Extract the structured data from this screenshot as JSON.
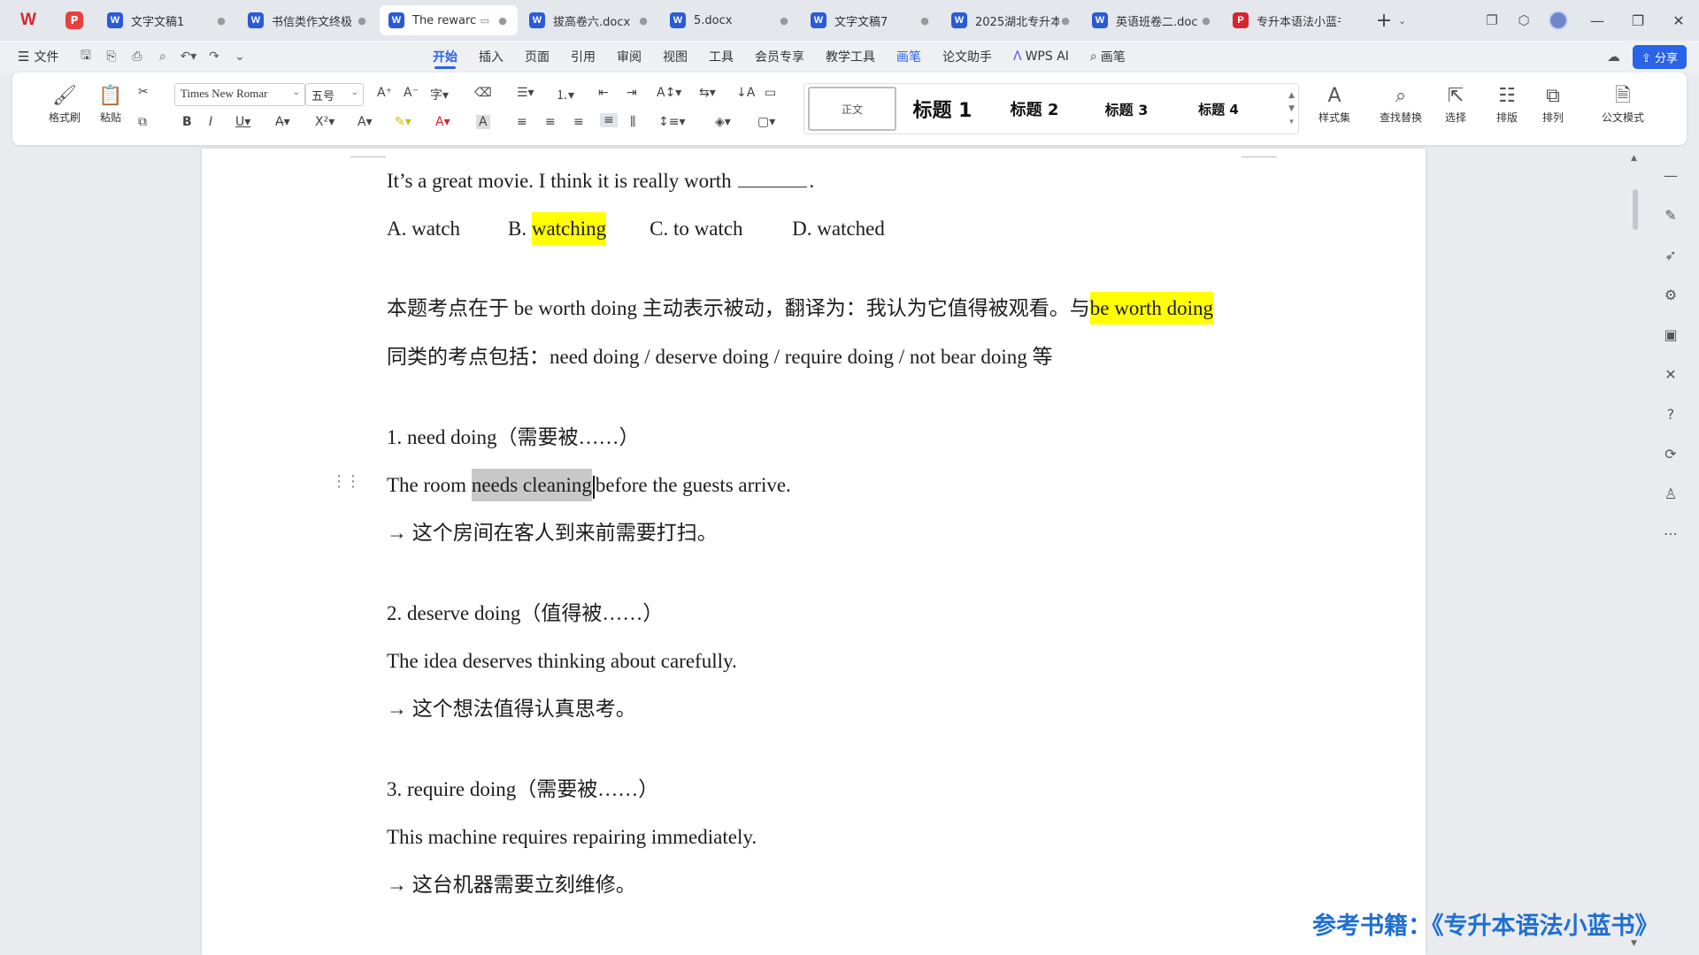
{
  "tabbar": {
    "app_logo": "W",
    "pdf_badge": "P",
    "tabs": [
      {
        "icon": "W",
        "label": "文字文稿1",
        "close": "●"
      },
      {
        "icon": "W",
        "label": "书信类作文终极",
        "close": "●"
      },
      {
        "icon": "W",
        "label": "The rewarc",
        "close": "●"
      },
      {
        "icon": "W",
        "label": "拔高卷六.docx",
        "close": "●"
      },
      {
        "icon": "W",
        "label": "5.docx",
        "close": "●"
      },
      {
        "icon": "W",
        "label": "文字文稿7",
        "close": "●"
      },
      {
        "icon": "W",
        "label": "2025湖北专升本",
        "close": "●"
      },
      {
        "icon": "W",
        "label": "英语班卷二.doc",
        "close": "●"
      },
      {
        "icon": "P",
        "label": "专升本语法小蓝书",
        "close": ""
      }
    ],
    "new_tab": "+",
    "tab_list": "⌄"
  },
  "menubar": {
    "file_label": "文件",
    "menus": [
      "开始",
      "插入",
      "页面",
      "引用",
      "审阅",
      "视图",
      "工具",
      "会员专享",
      "教学工具",
      "画笔",
      "论文助手",
      "WPS AI",
      "画笔"
    ],
    "share_label": "分享"
  },
  "ribbon": {
    "format_painter": "格式刷",
    "paste": "粘贴",
    "font_name": "Times New Romar",
    "font_size": "五号",
    "styles": {
      "normal": "正文",
      "h1": "标题 1",
      "h2": "标题 2",
      "h3": "标题 3",
      "h4": "标题 4"
    },
    "style_set": "样式集",
    "find_replace": "查找替换",
    "select": "选择",
    "layout": "排版",
    "arrange": "排列",
    "official_mode": "公文模式"
  },
  "document": {
    "q_line_a": "It’s a great movie. I think it is really worth",
    "q_line_b": ".",
    "options": {
      "a": "A. watch",
      "b_prefix": "B.",
      "b_word": "watching",
      "c": "C. to watch",
      "d": "D. watched"
    },
    "explain_1a": "本题考点在于 be worth doing 主动表示被动，翻译为：我认为它值得被观看。与",
    "explain_1b": "be worth doing",
    "explain_2": "同类的考点包括：need doing / deserve doing / require doing / not bear doing 等",
    "item1_title": "1. need doing（需要被……）",
    "item1_ex_a": "The room",
    "item1_ex_sel": "needs cleaning",
    "item1_ex_b": "before the guests arrive.",
    "item1_tr": "→ 这个房间在客人到来前需要打扫。",
    "item2_title": "2. deserve doing（值得被……）",
    "item2_ex": "The idea deserves thinking about carefully.",
    "item2_tr": "→ 这个想法值得认真思考。",
    "item3_title": "3. require doing（需要被……）",
    "item3_ex": "This machine requires repairing immediately.",
    "item3_tr": "→ 这台机器需要立刻维修。"
  },
  "reference": "参考书籍：《专升本语法小蓝书》",
  "colors": {
    "accent": "#2a62e8",
    "highlight": "#ffff00",
    "selection": "#c8c8c8",
    "reference": "#1f6fd1"
  }
}
